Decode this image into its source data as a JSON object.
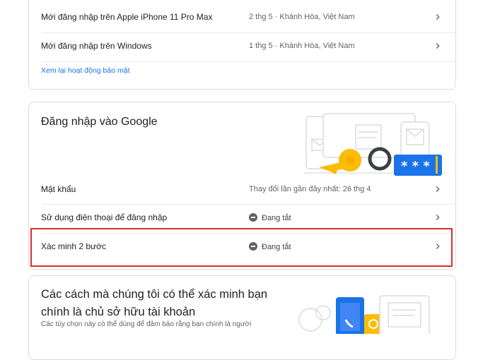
{
  "recent_activity": {
    "events": [
      {
        "label": "Mới đăng nhập trên Apple iPhone 11 Pro Max",
        "detail": "2 thg 5 · Khánh Hòa, Việt Nam"
      },
      {
        "label": "Mới đăng nhập trên Windows",
        "detail": "1 thg 5 · Khánh Hòa, Việt Nam"
      }
    ],
    "review_link": "Xem lại hoạt động bảo mật"
  },
  "signin": {
    "title": "Đăng nhập vào Google",
    "illustration_icon": "key-and-password-illustration",
    "rows": [
      {
        "label": "Mật khẩu",
        "value": "Thay đổi lần gần đây nhất: 26 thg 4"
      },
      {
        "label": "Sử dụng điện thoại để đăng nhập",
        "value": "Đang tắt"
      },
      {
        "label": "Xác minh 2 bước",
        "value": "Đang tắt"
      }
    ]
  },
  "verify": {
    "title": "Các cách mà chúng tôi có thể xác minh bạn chính là chủ sở hữu tài khoản",
    "description": "Các tùy chọn này có thể dùng để đảm bảo rằng bạn chính là người",
    "illustration_icon": "phone-verification-illustration"
  },
  "colors": {
    "accent": "#1a73e8",
    "highlight": "#d93025",
    "status": "#5f6368"
  }
}
